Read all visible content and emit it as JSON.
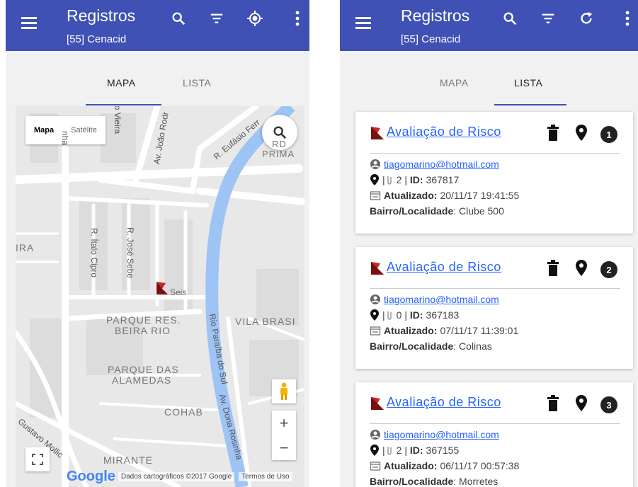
{
  "left": {
    "appbar": {
      "title": "Registros",
      "subtitle": "[55] Cenacid"
    },
    "tabs": [
      "MAPA",
      "LISTA"
    ],
    "map": {
      "type_controls": {
        "map": "Mapa",
        "satellite": "Satélite"
      },
      "areas": [
        "PARQUE RES.",
        "BEIRA RIO",
        "PARQUE DAS",
        "ALAMEDAS",
        "VILA BRASI",
        "COHAB",
        "MIRANTE",
        "PRIMA",
        "IRA"
      ],
      "streets": [
        "R. Eufásio Ferr",
        "Av. João Rodr",
        "R. Ítalo Cipro",
        "R. José Sebe",
        "Rio Paraíba do Sul",
        "Av. Dona Rosinha",
        "Gustavo Mollic",
        "o Vieira",
        "nha"
      ],
      "marker_label": "Seis",
      "google": "Google",
      "attribution": "Dados cartográficos ©2017 Google",
      "terms": "Termos de Uso",
      "zoom_in": "+",
      "zoom_out": "−"
    }
  },
  "right": {
    "appbar": {
      "title": "Registros",
      "subtitle": "[55] Cenacid"
    },
    "tabs": [
      "MAPA",
      "LISTA"
    ],
    "cards": [
      {
        "title": "Avaliação de Risco",
        "number": "1",
        "email": "tiagomarino@hotmail.com",
        "attachments": "2",
        "id_label": "ID:",
        "id": "367817",
        "updated_label": "Atualizado:",
        "updated": "20/11/17 19:41:55",
        "bairro_label": "Bairro/Localidade",
        "bairro": ": Clube 500"
      },
      {
        "title": "Avaliação de Risco",
        "number": "2",
        "email": "tiagomarino@hotmail.com",
        "attachments": "0",
        "id_label": "ID:",
        "id": "367183",
        "updated_label": "Atualizado:",
        "updated": "07/11/17 11:39:01",
        "bairro_label": "Bairro/Localidade",
        "bairro": ": Colinas"
      },
      {
        "title": "Avaliação de Risco",
        "number": "3",
        "email": "tiagomarino@hotmail.com",
        "attachments": "2",
        "id_label": "ID:",
        "id": "367155",
        "updated_label": "Atualizado:",
        "updated": "06/11/17 00:57:38",
        "bairro_label": "Bairro/Localidade",
        "bairro": ": Morretes"
      }
    ]
  },
  "colors": {
    "primary": "#3f51b5",
    "link": "#2962ff",
    "river": "#9ec3f5",
    "flag": "#c62828"
  }
}
